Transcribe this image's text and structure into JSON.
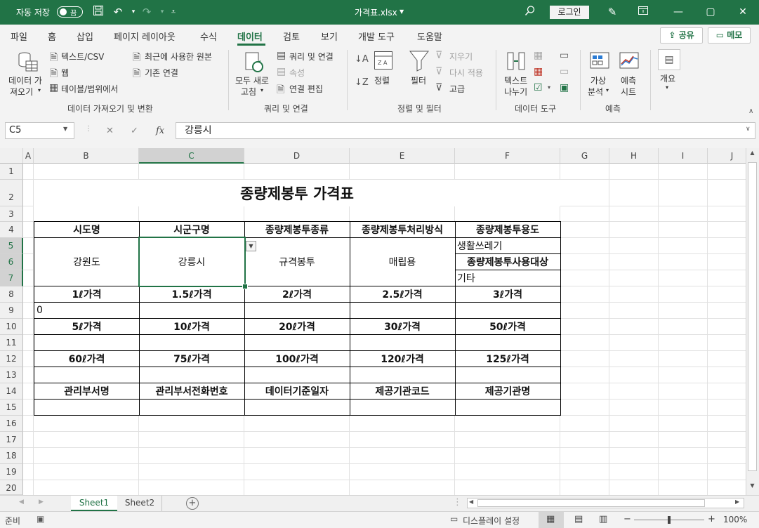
{
  "titlebar": {
    "autosave_label": "자동 저장",
    "autosave_state": "끔",
    "filename": "가격표.xlsx",
    "login_label": "로그인"
  },
  "ribbon_tabs": [
    "파일",
    "홈",
    "삽입",
    "페이지 레이아웃",
    "수식",
    "데이터",
    "검토",
    "보기",
    "개발 도구",
    "도움말"
  ],
  "active_tab": "데이터",
  "share_label": "공유",
  "memo_label": "메모",
  "ribbon": {
    "get_data": {
      "big_button_line1": "데이터 가",
      "big_button_line2": "져오기",
      "text_csv": "텍스트/CSV",
      "web": "웹",
      "table_range": "테이블/범위에서",
      "recent_sources": "최근에 사용한 원본",
      "existing_connections": "기존 연결",
      "group_label": "데이터 가져오기 및 변환"
    },
    "queries": {
      "refresh_all_line1": "모두 새로",
      "refresh_all_line2": "고침",
      "queries_connections": "쿼리 및 연결",
      "properties": "속성",
      "edit_links": "연결 편집",
      "group_label": "쿼리 및 연결"
    },
    "sort_filter": {
      "sort": "정렬",
      "filter": "필터",
      "clear": "지우기",
      "reapply": "다시 적용",
      "advanced": "고급",
      "group_label": "정렬 및 필터"
    },
    "data_tools": {
      "text_to_columns_line1": "텍스트",
      "text_to_columns_line2": "나누기",
      "group_label": "데이터 도구"
    },
    "forecast": {
      "what_if_line1": "가상",
      "what_if_line2": "분석",
      "forecast_sheet_line1": "예측",
      "forecast_sheet_line2": "시트",
      "group_label": "예측"
    },
    "outline": {
      "label": "개요"
    }
  },
  "formula_bar": {
    "name_box": "C5",
    "formula": "강릉시",
    "fx": "fx"
  },
  "columns": [
    "A",
    "B",
    "C",
    "D",
    "E",
    "F",
    "G",
    "H",
    "I",
    "J"
  ],
  "rows": [
    "1",
    "2",
    "3",
    "4",
    "5",
    "6",
    "7",
    "8",
    "9",
    "10",
    "11",
    "12",
    "13",
    "14",
    "15",
    "16",
    "17",
    "18",
    "19",
    "20"
  ],
  "sheet": {
    "title": "종량제봉투 가격표",
    "headers_row4": [
      "시도명",
      "시군구명",
      "종량제봉투종류",
      "종량제봉투처리방식",
      "종량제봉투용도"
    ],
    "b5": "강원도",
    "c5": "강릉시",
    "d5": "규격봉투",
    "e5": "매립용",
    "f5": "생활쓰레기",
    "f6": "종량제봉투사용대상",
    "f7": "기타",
    "row8": [
      "1ℓ가격",
      "1.5ℓ가격",
      "2ℓ가격",
      "2.5ℓ가격",
      "3ℓ가격"
    ],
    "b9": "0",
    "row10": [
      "5ℓ가격",
      "10ℓ가격",
      "20ℓ가격",
      "30ℓ가격",
      "50ℓ가격"
    ],
    "row12": [
      "60ℓ가격",
      "75ℓ가격",
      "100ℓ가격",
      "120ℓ가격",
      "125ℓ가격"
    ],
    "row14": [
      "관리부서명",
      "관리부서전화번호",
      "데이터기준일자",
      "제공기관코드",
      "제공기관명"
    ]
  },
  "sheet_tabs": [
    "Sheet1",
    "Sheet2"
  ],
  "status": {
    "ready": "준비",
    "display_settings": "디스플레이 설정",
    "zoom": "100%"
  },
  "colors": {
    "accent": "#217346"
  }
}
